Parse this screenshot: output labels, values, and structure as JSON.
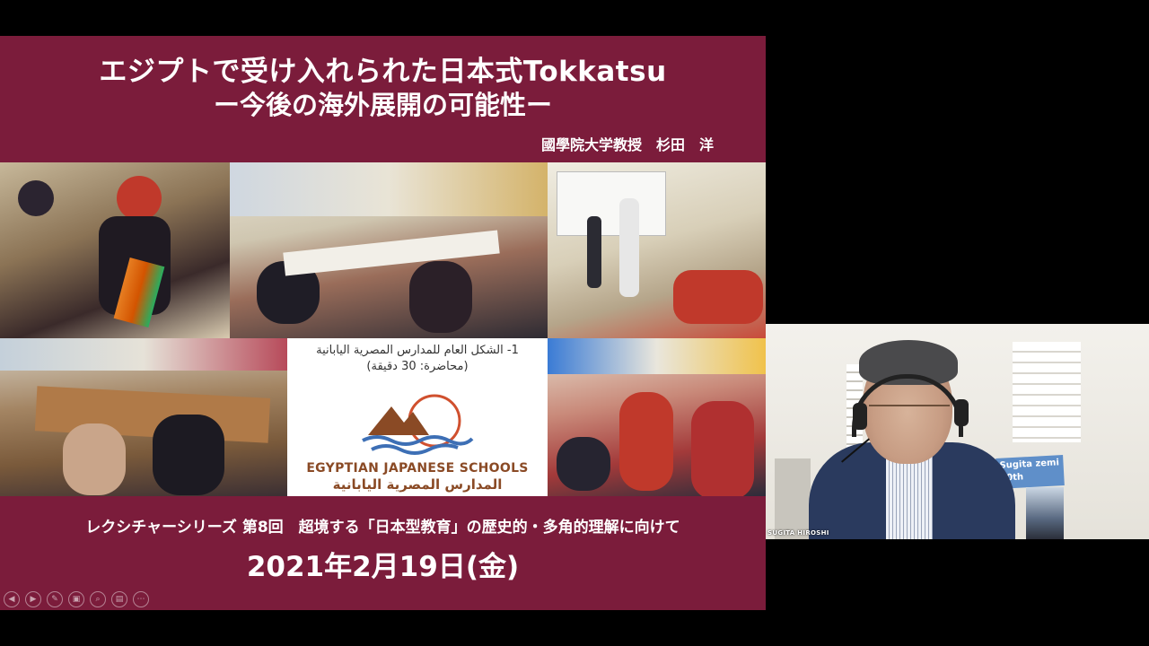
{
  "slide": {
    "title_line1": "エジプトで受け入れられた日本式Tokkatsu",
    "title_line2": "ー今後の海外展開の可能性ー",
    "author": "國學院大学教授　杉田　洋",
    "series": "レクシチャーシリーズ 第8回　超境する「日本型教育」の歴史的・多角的理解に向けて",
    "date": "2021年2月19日(金)",
    "logo_panel": {
      "arabic_line1": "1- الشكل العام للمدارس المصرية اليابانية",
      "arabic_line2": "(محاضرة: 30 دقيقة)",
      "school_name_en": "EGYPTIAN JAPANESE SCHOOLS",
      "school_name_ar": "المدارس المصرية اليابانية"
    },
    "nav_icons": [
      "prev-icon",
      "next-icon",
      "pen-icon",
      "slides-icon",
      "zoom-icon",
      "subtitle-icon",
      "more-icon"
    ],
    "nav_glyphs": [
      "◀",
      "▶",
      "✎",
      "▣",
      "⌕",
      "▤",
      "⋯"
    ],
    "colors": {
      "slide_bg": "#7b1c3b",
      "logo_brown": "#8a4a25",
      "logo_blue": "#3d6fb5",
      "logo_red": "#d0502e"
    }
  },
  "video": {
    "participant_name": "SUGITA HIROSHI",
    "banner_text": "Sugita zemi 10th"
  }
}
